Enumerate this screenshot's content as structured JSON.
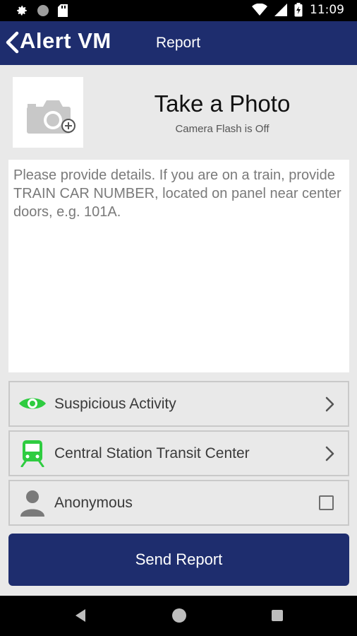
{
  "status_bar": {
    "time": "11:09",
    "left_icons": [
      "gear-icon",
      "circle-icon",
      "sd-card-icon"
    ],
    "right_icons": [
      "wifi-icon",
      "signal-icon",
      "battery-icon"
    ]
  },
  "app_bar": {
    "brand": "Alert VM",
    "title": "Report",
    "color": "#1e2d6e"
  },
  "photo": {
    "title": "Take a Photo",
    "flash_status": "Camera Flash is Off",
    "icon": "camera-add-icon"
  },
  "details": {
    "placeholder": "Please provide details. If you are on a train, provide TRAIN CAR NUMBER, located on panel near center doors, e.g. 101A.",
    "value": ""
  },
  "options": {
    "category": {
      "label": "Suspicious Activity",
      "icon": "eye-icon",
      "icon_color": "#2ecc40"
    },
    "location": {
      "label": "Central Station Transit Center",
      "icon": "train-icon",
      "icon_color": "#2ecc40"
    },
    "anonymous": {
      "label": "Anonymous",
      "icon": "person-icon",
      "checked": false
    }
  },
  "send_button": {
    "label": "Send Report"
  },
  "nav_bar": {
    "icons": [
      "back-triangle-icon",
      "home-circle-icon",
      "recents-square-icon"
    ]
  }
}
